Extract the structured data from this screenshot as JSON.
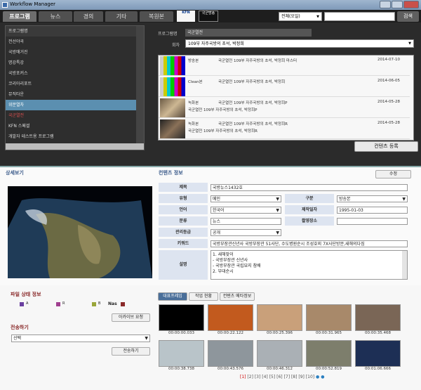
{
  "window": {
    "title": "Workflow Manager"
  },
  "nav": {
    "tabs": [
      "프로그램",
      "뉴스",
      "경의",
      "기타",
      "복원본"
    ],
    "logo1": "KFN",
    "logo2": "국군방송",
    "search_scope": "전체(오일)",
    "search_button": "검색"
  },
  "program_list": {
    "items": [
      "프로그램명",
      "전선야곡",
      "국방매거진",
      "명강특강",
      "국방포커스",
      "코리아리포트",
      "뮤직타운",
      "위문열차",
      "국군열전",
      "KFN 스페셜",
      "개발자 테스트용 프로그램"
    ],
    "highlighted_index": 7,
    "selected_index": 8
  },
  "program_info": {
    "program_label": "프로그램명",
    "program_value": "국군열전",
    "episode_label": "회차",
    "episode_value": "109부 자주국방의 초석, 박정희"
  },
  "episodes": [
    {
      "type": "방송본",
      "title": "국군열전 109부 자주국방의 초석, 박정희 마스터",
      "date": "2014-07-10"
    },
    {
      "type": "Clean본",
      "title": "국군열전 109부 자주국방의 초석, 박정희",
      "date": "2014-06-05"
    },
    {
      "type": "녹화본",
      "title": "국군열전 109부 자주국방의 초석, 박정희P",
      "title2": "국군열전 109부 자주국방의 초석, 박정희P",
      "date": "2014-05-28"
    },
    {
      "type": "녹화본",
      "title": "국군열전 109부 자주국방의 초석, 박정희R",
      "title2": "국군열전 109부 자주국방의 초석, 박정희R",
      "date": "2014-05-28"
    }
  ],
  "register_button": "컨텐츠 등록",
  "detail": {
    "preview_title": "상세보기",
    "content_title": "컨텐츠 정보",
    "edit_button": "수정",
    "fields": {
      "title_label": "제목",
      "title_value": "국방뉴스1432호",
      "type_label": "유형",
      "type_value": "메인",
      "kind_label": "구분",
      "kind_value": "방송본",
      "lang_label": "언어",
      "lang_value": "한국어",
      "date_label": "제작일자",
      "date_value": "1995-01-03",
      "cat_label": "분류",
      "cat_value": "뉴스",
      "place_label": "촬영장소",
      "place_value": "",
      "grade_label": "관리등급",
      "grade_value": "공개",
      "kw_label": "키워드",
      "kw_value": "국방부장관신년사 국방부장관 51사단, 수도병원순시 조성호외 7X사단방문,새해의다짐",
      "desc_label": "설명",
      "desc_lines": [
        "1. 새해맞이",
        "- 국방부장관 신년사",
        "- 국방부장관 국립묘지 참배",
        "2. 부대순시"
      ]
    }
  },
  "file_status": {
    "title": "파일 상태 정보",
    "flags": [
      "A",
      "R",
      "B",
      "Nas"
    ],
    "archive_button": "아카이브 요청"
  },
  "transfer": {
    "title": "전송하기",
    "select_value": "선택",
    "send_button": "전송하기"
  },
  "tabs_bottom": [
    "대표프레임",
    "작업 현황",
    "컨텐츠 메타정보"
  ],
  "frames": [
    {
      "tc": "00:00:00.033",
      "color": "#000000"
    },
    {
      "tc": "00:00:22.122",
      "color": "#c25a1e"
    },
    {
      "tc": "00:00:25.396",
      "color": "#c9a07a"
    },
    {
      "tc": "00:00:31.965",
      "color": "#a8896a"
    },
    {
      "tc": "00:00:35.468",
      "color": "#7a6656"
    },
    {
      "tc": "00:00:38.738",
      "color": "#b9c4c9"
    },
    {
      "tc": "00:00:43.576",
      "color": "#8e969c"
    },
    {
      "tc": "00:00:46.312",
      "color": "#aab0b5"
    },
    {
      "tc": "00:00:52.819",
      "color": "#7d7e6c"
    },
    {
      "tc": "00:01:06.666",
      "color": "#1d2f55"
    }
  ],
  "pagination": [
    "[1]",
    "[2]",
    "[3]",
    "[4]",
    "[5]",
    "[6]",
    "[7]",
    "[8]",
    "[9]",
    "[10]"
  ]
}
